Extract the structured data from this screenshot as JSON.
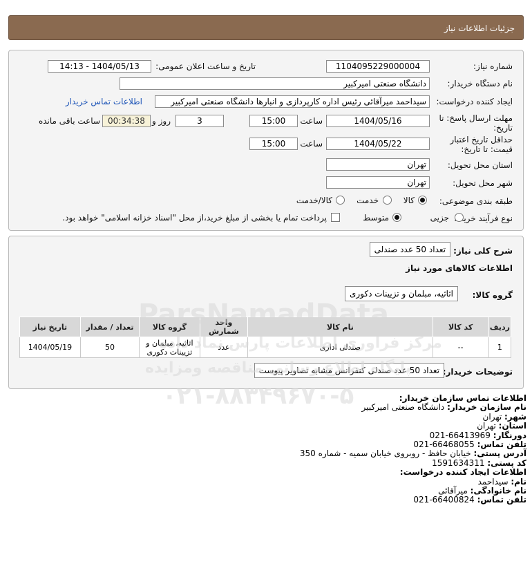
{
  "header": {
    "title": "جزئیات اطلاعات نیاز"
  },
  "form": {
    "need_number_label": "شماره نیاز:",
    "need_number": "1104095229000004",
    "announce_label": "تاریخ و ساعت اعلان عمومی:",
    "announce_value": "1404/05/13 - 14:13",
    "buyer_org_label": "نام دستگاه خریدار:",
    "buyer_org": "دانشگاه صنعتی امیرکبیر",
    "creator_label": "ایجاد کننده درخواست:",
    "creator": "سیداحمد میرآقائی رئیس اداره کارپردازی و انبارها دانشگاه صنعتی امیرکبیر",
    "contact_link": "اطلاعات تماس خریدار",
    "deadline_label_1": "مهلت ارسال پاسخ: تا",
    "deadline_label_2": "تاریخ:",
    "deadline_date": "1404/05/16",
    "time_label": "ساعت",
    "deadline_time": "15:00",
    "days_value": "3",
    "days_label": "روز و",
    "timer_value": "00:34:38",
    "remaining_label": "ساعت باقی مانده",
    "validity_label_1": "حداقل تاریخ اعتبار",
    "validity_label_2": "قیمت: تا تاریخ:",
    "validity_date": "1404/05/22",
    "validity_time": "15:00",
    "province_label": "استان محل تحویل:",
    "province": "تهران",
    "city_label": "شهر محل تحویل:",
    "city": "تهران",
    "category_label": "طبقه بندی موضوعی:",
    "category_options": [
      "کالا",
      "خدمت",
      "کالا/خدمت"
    ],
    "category_selected": "کالا",
    "process_label": "نوع فرآیند خرید :",
    "process_options": [
      "جزیی",
      "متوسط"
    ],
    "process_selected": "متوسط",
    "payment_note": "پرداخت تمام یا بخشی از مبلغ خرید،از محل \"اسناد خزانه اسلامی\" خواهد بود."
  },
  "need": {
    "description_label": "شرح کلی نیاز:",
    "description": "تعداد 50 عدد صندلی",
    "goods_info_label": "اطلاعات کالاهای مورد نیاز",
    "group_label": "گروه کالا:",
    "group": "اثاثیه، مبلمان و تزیینات دکوری",
    "table": {
      "headers": [
        "ردیف",
        "کد کالا",
        "نام کالا",
        "واحد شمارش",
        "گروه کالا",
        "تعداد / مقدار",
        "تاریخ نیاز"
      ],
      "rows": [
        [
          "1",
          "--",
          "صندلی اداری",
          "عدد",
          "اثاثیه، مبلمان و تزیینات دکوری",
          "50",
          "1404/05/19"
        ]
      ]
    },
    "buyer_notes_label": "توضیحات خریدار:",
    "buyer_notes": "تعداد 50 عدد صندلی کنفرانس مشابه تصاویر پیوست"
  },
  "contact": {
    "lines": [
      {
        "label": "اطلاعات تماس سازمان خریدار:",
        "value": ""
      },
      {
        "label": "نام سازمان خریدار:",
        "value": "دانشگاه صنعتی امیرکبیر"
      },
      {
        "label": "شهر:",
        "value": "تهران"
      },
      {
        "label": "استان:",
        "value": "تهران"
      },
      {
        "label": "دورنگار:",
        "value": "66413969-021"
      },
      {
        "label": "تلفن تماس:",
        "value": "66468055-021"
      },
      {
        "label": "آدرس پستی:",
        "value": "خیابان حافظ - روبروی خیابان سمیه - شماره 350"
      },
      {
        "label": "کد پستی:",
        "value": "1591634311"
      },
      {
        "label": "اطلاعات ایجاد کننده درخواست:",
        "value": ""
      },
      {
        "label": "نام:",
        "value": "سیداحمد"
      },
      {
        "label": "نام خانوادگی:",
        "value": "میرآقائی"
      },
      {
        "label": "تلفن تماس:",
        "value": "66400824-021"
      }
    ]
  },
  "watermark": {
    "brand": "ParsNamadData",
    "line1": "مرکز فراوری اطلاعات پارس نماد داده",
    "line2": "پایگاه اطلاع رسانی مناقصه ومزایده",
    "phone": "۰۲۱-۸۸۳۴۹۶۷۰-۵"
  }
}
